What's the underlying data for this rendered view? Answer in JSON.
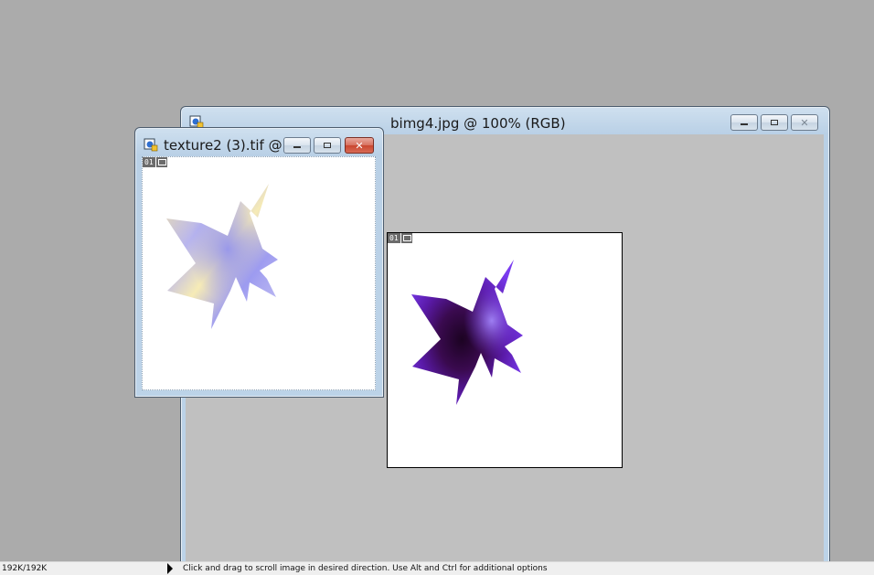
{
  "back_window": {
    "title": "bimg4.jpg @ 100% (RGB)",
    "controls": {
      "minimize": "—",
      "restore": "◻",
      "close": "✕"
    },
    "doc_badges": {
      "layer": "01"
    }
  },
  "front_window": {
    "title": "texture2 (3).tif @ ...",
    "controls": {
      "minimize": "—",
      "restore": "◻",
      "close": "✕"
    },
    "doc_badges": {
      "layer": "01"
    }
  },
  "statusbar": {
    "memory": "192K/192K",
    "hint": "Click and drag to scroll image in desired direction.  Use Alt and Ctrl for additional options"
  },
  "colors": {
    "workspace": "#ababab",
    "canvas": "#c0c0c0",
    "shape_dark": "#3a0a4f",
    "shape_purple": "#7a3cf0",
    "texture_blue": "#8f8ff0",
    "texture_cream": "#f3e6a8"
  }
}
